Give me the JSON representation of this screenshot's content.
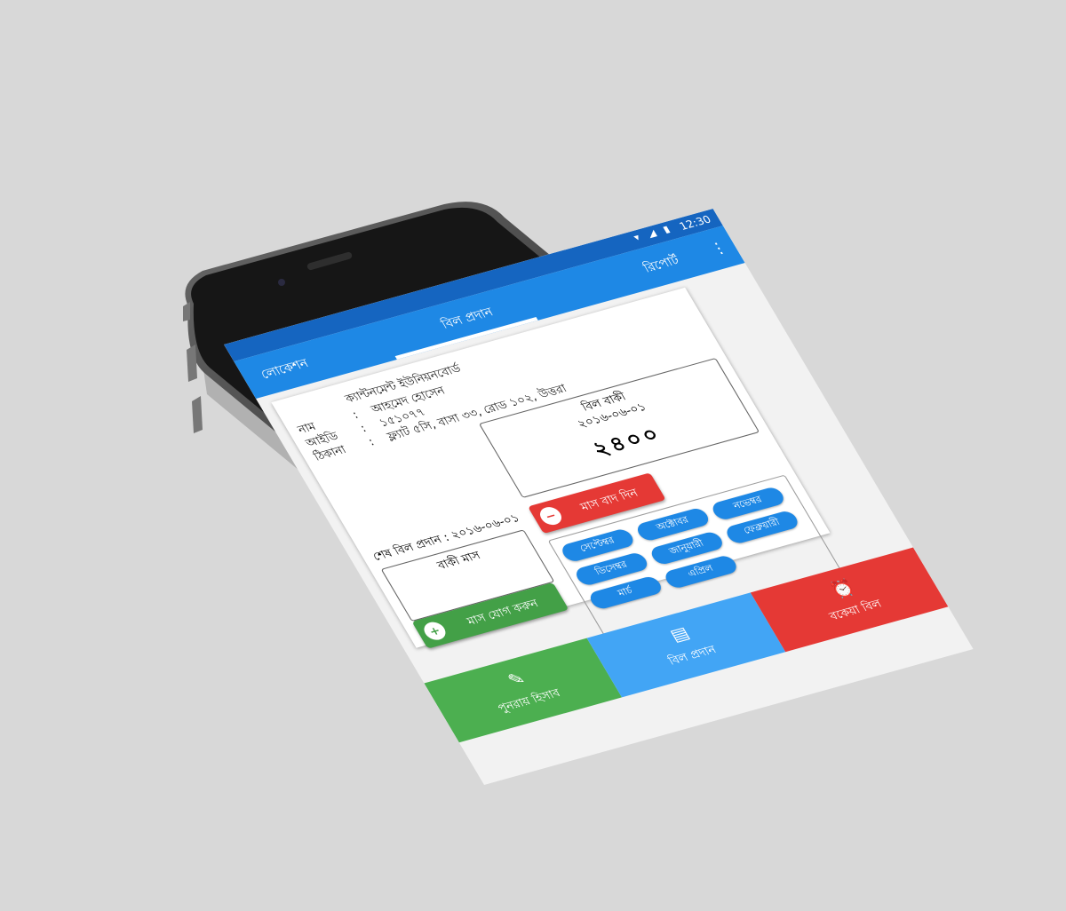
{
  "status_bar": {
    "icons": "▾ ◢ ▮",
    "time": "12:30"
  },
  "app_bar": {
    "tabs": [
      {
        "label": "লোকেশন"
      },
      {
        "label": "বিল প্রদান"
      },
      {
        "label": "রিপোর্ট"
      }
    ],
    "overflow_icon": "more-vert-icon"
  },
  "customer": {
    "org": "ক্যান্টনমেন্ট ইউনিয়নবোর্ড",
    "name_label": "নাম",
    "name": "আহমেদ হোসেন",
    "id_label": "আইডি",
    "id": "১৫১০৭৭",
    "address_label": "ঠিকানা",
    "address": "ফ্ল্যাট ৫সি, বাসা ৩৩, রোড ১০২, উত্তরা",
    "separator": ":"
  },
  "bill": {
    "due_label": "বিল বাকী",
    "date_text": "২০১৬-০৬-০১",
    "amount": "২৪০০",
    "last_paid_text": "শেষ বিল প্রদান : ২০১৬-০৬-০১",
    "remaining_label": "বাকী মাস"
  },
  "actions": {
    "remove_month": "মাস বাদ দিন",
    "add_month": "মাস যোগ করুন"
  },
  "months": [
    "সেপ্টেম্বর",
    "অক্টোবর",
    "নভেম্বর",
    "ডিসেম্বর",
    "জানুয়ারী",
    "ফেব্রুয়ারী",
    "মার্চ",
    "এপ্রিল"
  ],
  "bottom_nav": [
    {
      "label": "পুনরায় হিসাব",
      "icon": "pencil-icon",
      "glyph": "✎"
    },
    {
      "label": "বিল প্রদান",
      "icon": "bill-icon",
      "glyph": "▤"
    },
    {
      "label": "বকেয়া বিল",
      "icon": "alarm-icon",
      "glyph": "⏰"
    }
  ],
  "colors": {
    "background": "#d8d8d8",
    "phone_body": "#1b1b1b",
    "app_bar": "#1e88e5",
    "status_bar": "#1565c0",
    "green": "#4caf50",
    "blue": "#42a5f5",
    "red": "#e53935"
  }
}
